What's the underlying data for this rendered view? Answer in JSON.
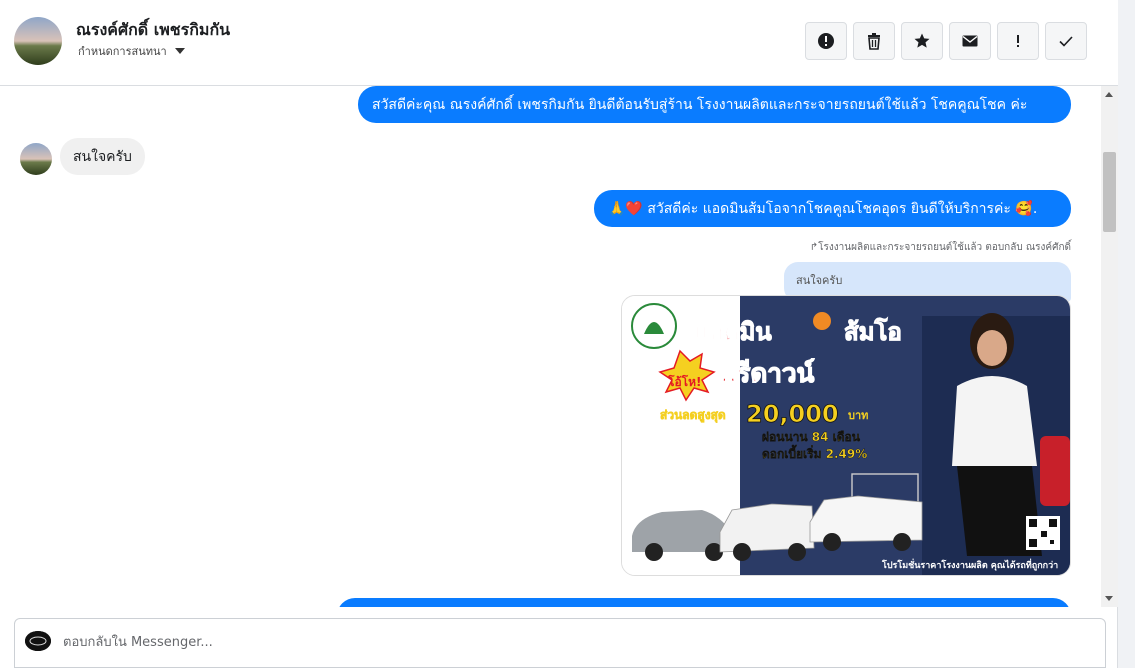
{
  "header": {
    "contact_name": "ณรงค์ศักดิ์ เพชรกิมกัน",
    "assign_label": "กำหนดการสนทนา",
    "actions": [
      {
        "icon": "alert-circle-icon",
        "name": "mark-spam-button"
      },
      {
        "icon": "trash-icon",
        "name": "delete-button"
      },
      {
        "icon": "star-icon",
        "name": "star-button"
      },
      {
        "icon": "envelope-icon",
        "name": "mark-unread-button"
      },
      {
        "icon": "exclamation-icon",
        "name": "follow-up-button"
      },
      {
        "icon": "check-icon",
        "name": "mark-done-button"
      }
    ]
  },
  "thread": {
    "messages": [
      {
        "direction": "out",
        "text": "สวัสดีค่ะคุณ ณรงค์ศักดิ์ เพชรกิมกัน ยินดีต้อนรับสู่ร้าน โรงงานผลิตและกระจายรถยนต์ใช้แล้ว โชคคูณโชค ค่ะ"
      },
      {
        "direction": "in",
        "text": "สนใจครับ"
      },
      {
        "direction": "out",
        "text": "🙏❤️ สวัสดีค่ะ แอดมินส้มโอจากโชคคูณโชคอุดร ยินดีให้บริการค่ะ 🥰."
      }
    ],
    "reply_meta": "โรงงานผลิตและกระจายรถยนต์ใช้แล้ว ตอบกลับ ณรงค์ศักดิ์",
    "quoted_text": "สนใจครับ",
    "promo": {
      "headline": "แอดมิน",
      "headline2": "ส้มโอ",
      "badge": "โอ้โห!",
      "free_down": "ฟรีดาวน์",
      "discount_label": "ส่วนลดสูงสุด",
      "discount_value": "20,000",
      "discount_unit": "บาท",
      "installment": "ผ่อนนาน 84 เดือน",
      "interest": "ดอกเบี้ยเริ่ม 2.49%",
      "footer": "โปรโมชั่นราคาโรงงานผลิต คุณได้รถที่ถูกกว่า"
    }
  },
  "composer": {
    "placeholder": "ตอบกลับใน Messenger..."
  },
  "colors": {
    "bubble_out": "#0a7cff",
    "bubble_in": "#f0f0f0",
    "accent": "#0a7cff"
  }
}
